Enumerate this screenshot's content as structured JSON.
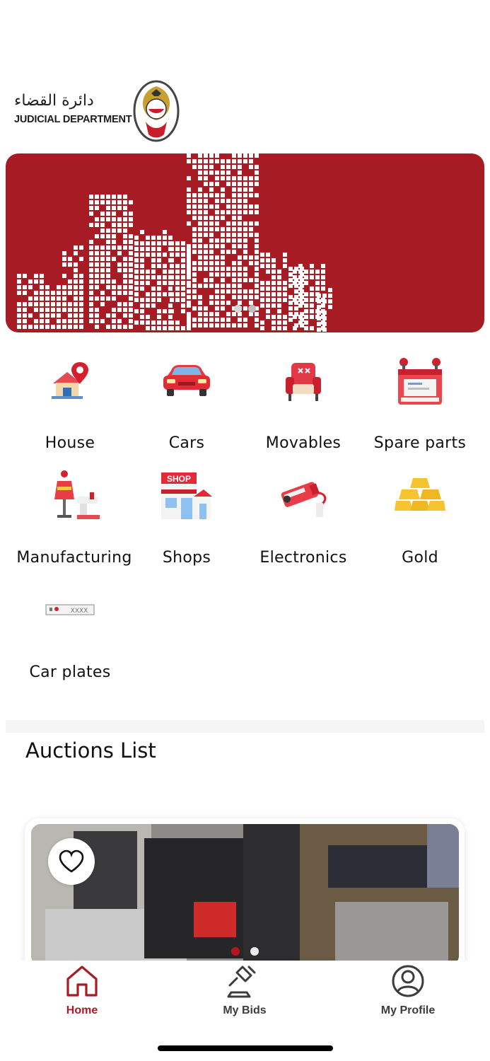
{
  "header": {
    "logo_arabic": "دائرة القضاء",
    "logo_english": "JUDICIAL DEPARTMENT"
  },
  "banner": {
    "slide_count": 2,
    "active_slide": 2
  },
  "categories": [
    {
      "label": "House",
      "icon": "house-location-icon"
    },
    {
      "label": "Cars",
      "icon": "car-icon"
    },
    {
      "label": "Movables",
      "icon": "armchair-icon"
    },
    {
      "label": "Spare parts",
      "icon": "battery-icon"
    },
    {
      "label": "Manufacturing",
      "icon": "sewing-mannequin-icon"
    },
    {
      "label": "Shops",
      "icon": "shop-icon"
    },
    {
      "label": "Electronics",
      "icon": "security-camera-icon"
    },
    {
      "label": "Gold",
      "icon": "gold-bars-icon"
    },
    {
      "label": "Car plates",
      "icon": "license-plate-icon"
    }
  ],
  "plate_text": "XXXX",
  "shop_sign": "SHOP",
  "auctions": {
    "title": "Auctions List",
    "card_pages": 2,
    "card_active_page": 1
  },
  "tabs": [
    {
      "label": "Home",
      "icon": "home-icon",
      "active": true
    },
    {
      "label": "My Bids",
      "icon": "gavel-icon",
      "active": false
    },
    {
      "label": "My Profile",
      "icon": "user-icon",
      "active": false
    }
  ],
  "colors": {
    "brand_red": "#a61b24",
    "tab_inactive": "#3c3c3c"
  }
}
